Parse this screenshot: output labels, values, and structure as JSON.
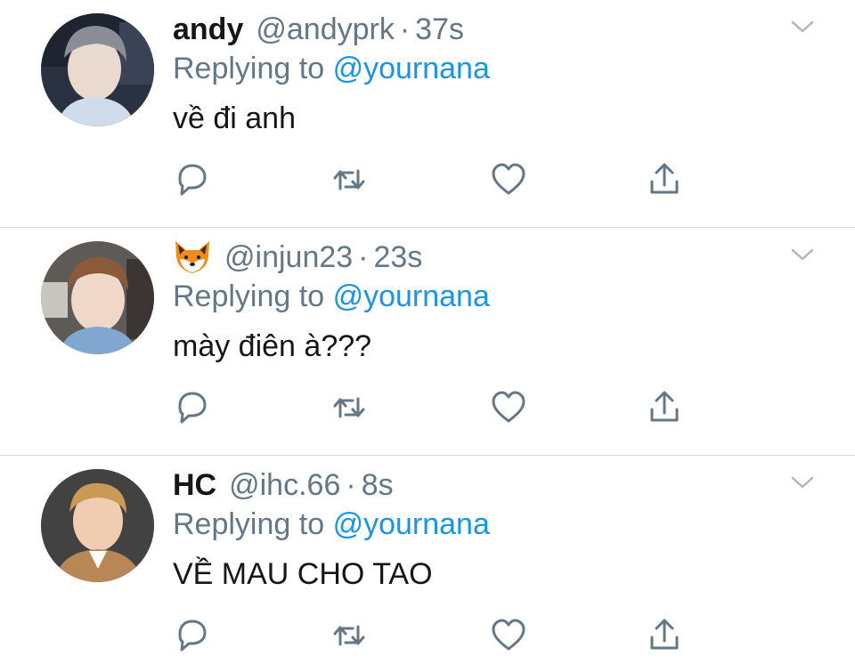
{
  "colors": {
    "name": "#14171a",
    "secondary": "#657786",
    "link": "#1b95e0",
    "divider": "#cfd8dd",
    "icon": "#657786"
  },
  "tweets": [
    {
      "name": "andy",
      "handle": "@andyprk",
      "separator": "·",
      "time": "37s",
      "reply_prefix": "Replying to",
      "reply_handle": "@yournana",
      "text": "về đi anh",
      "avatar_icon": "avatar-photo"
    },
    {
      "name_icon": "fox-face-emoji",
      "handle": "@injun23",
      "separator": "·",
      "time": "23s",
      "reply_prefix": "Replying to",
      "reply_handle": "@yournana",
      "text": "mày điên à???",
      "avatar_icon": "avatar-photo"
    },
    {
      "name": "HC",
      "handle": "@ihc.66",
      "separator": "·",
      "time": "8s",
      "reply_prefix": "Replying to",
      "reply_handle": "@yournana",
      "text": "VỀ MAU CHO TAO",
      "avatar_icon": "avatar-photo"
    }
  ],
  "action_icons": [
    "reply-icon",
    "retweet-icon",
    "like-icon",
    "share-icon"
  ],
  "menu_icon": "chevron-down-icon"
}
